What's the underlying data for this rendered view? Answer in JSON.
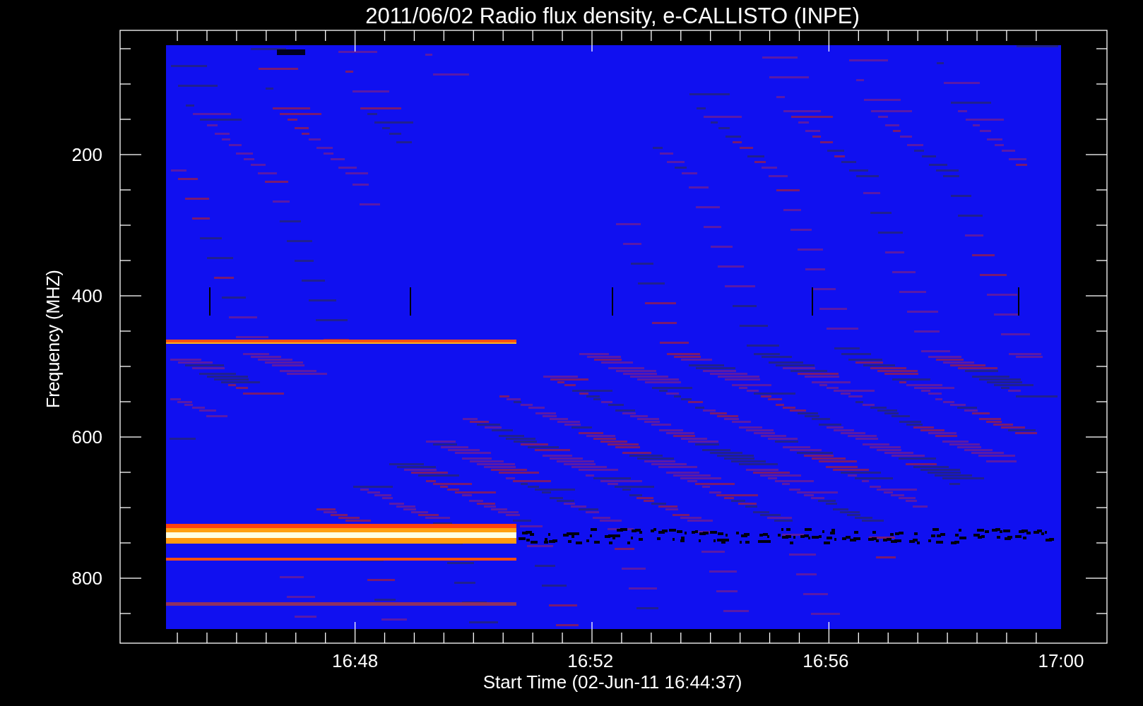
{
  "title": "2011/06/02  Radio flux density, e-CALLISTO (INPE)",
  "x_axis": {
    "label": "Start Time (02-Jun-11 16:44:37)",
    "ticks": [
      "16:48",
      "16:52",
      "16:56",
      "17:00"
    ]
  },
  "y_axis": {
    "label": "Frequency (MHZ)",
    "ticks": [
      "200",
      "400",
      "600",
      "800"
    ]
  }
}
